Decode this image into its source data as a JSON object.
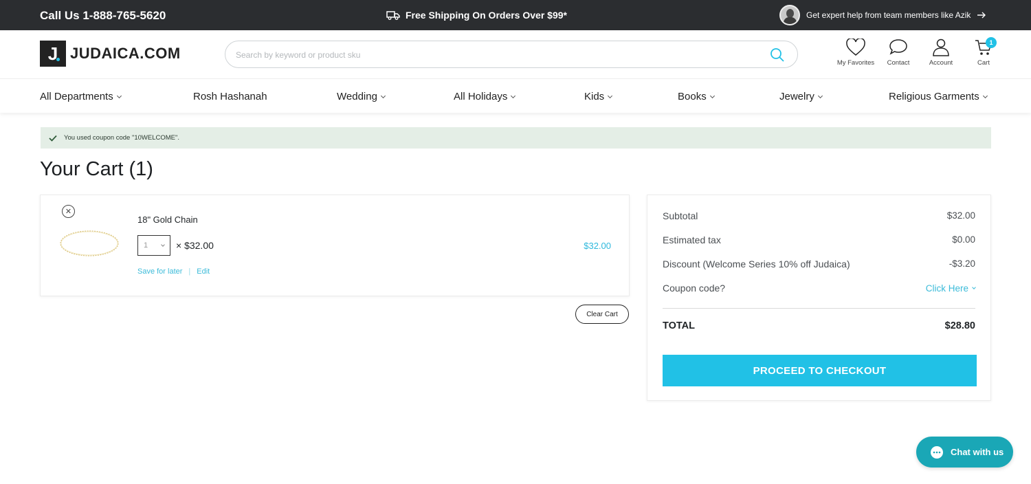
{
  "topbar": {
    "phone": "Call Us 1-888-765-5620",
    "shipping": "Free Shipping On Orders Over $99*",
    "expert": "Get expert help from team members like Azik"
  },
  "header": {
    "logo_letter": "J",
    "logo_word": "JUDAICA.COM",
    "search_placeholder": "Search by keyword or product sku",
    "icons": {
      "favorites": "My Favorites",
      "contact": "Contact",
      "account": "Account",
      "cart": "Cart",
      "cart_count": "1"
    }
  },
  "nav": {
    "items": [
      "All Departments",
      "Rosh Hashanah",
      "Wedding",
      "All Holidays",
      "Kids",
      "Books",
      "Jewelry",
      "Religious Garments"
    ]
  },
  "notice": {
    "text": "You used coupon code \"10WELCOME\"."
  },
  "page": {
    "title": "Your Cart (1)"
  },
  "cart": {
    "item": {
      "name": "18\" Gold Chain",
      "quantity": "1",
      "unit_price": "× $32.00",
      "line_total": "$32.00",
      "save_for_later": "Save for later",
      "separator": "|",
      "edit": "Edit"
    },
    "clear_label": "Clear Cart"
  },
  "summary": {
    "subtotal_label": "Subtotal",
    "subtotal_value": "$32.00",
    "tax_label": "Estimated tax",
    "tax_value": "$0.00",
    "discount_label": "Discount (Welcome Series 10% off Judaica)",
    "discount_value": "-$3.20",
    "coupon_label": "Coupon code?",
    "coupon_link": "Click Here",
    "total_label": "TOTAL",
    "total_value": "$28.80",
    "checkout_label": "PROCEED TO CHECKOUT"
  },
  "chat": {
    "label": "Chat with us"
  },
  "colors": {
    "accent": "#21c1e6",
    "topbar": "#2b2d30",
    "notice_bg": "#e4eee6",
    "chat": "#1aa7b6"
  }
}
